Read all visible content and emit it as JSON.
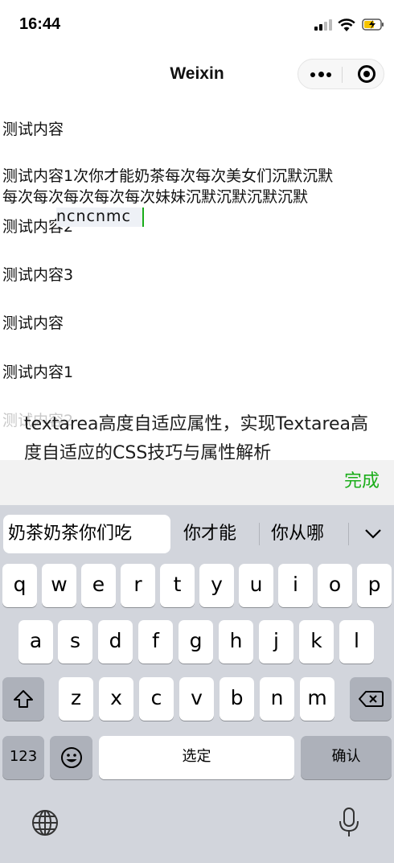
{
  "status_bar": {
    "time": "16:44",
    "icons": [
      "signal-icon",
      "wifi-icon",
      "battery-charging-icon"
    ]
  },
  "nav": {
    "title": "Weixin",
    "more_icon": "more-dots-icon",
    "close_icon": "mini-program-close-icon"
  },
  "content": {
    "line1": "测试内容",
    "textarea_text": "测试内容1次你才能奶茶每次每次美女们沉默沉默每次每次每次每次每次妹妹沉默沉默沉默沉默",
    "typing_text": "ncncnmc",
    "overlapped_line": "测试内容2",
    "line3": "测试内容3",
    "line4": "测试内容",
    "line5": "测试内容1",
    "ghost_line": "测试内容2"
  },
  "watermark": "textarea高度自适应属性，实现Textarea高度自适应的CSS技巧与属性解析",
  "done_button": "完成",
  "keyboard": {
    "candidates": [
      "奶茶奶茶你们吃",
      "你才能",
      "你从哪"
    ],
    "row1": [
      "q",
      "w",
      "e",
      "r",
      "t",
      "y",
      "u",
      "i",
      "o",
      "p"
    ],
    "row2": [
      "a",
      "s",
      "d",
      "f",
      "g",
      "h",
      "j",
      "k",
      "l"
    ],
    "row3": [
      "z",
      "x",
      "c",
      "v",
      "b",
      "n",
      "m"
    ],
    "numbers_key": "123",
    "space_key": "选定",
    "return_key": "确认"
  },
  "colors": {
    "accent": "#1aad19",
    "keyboard_bg": "#d2d5dc"
  }
}
